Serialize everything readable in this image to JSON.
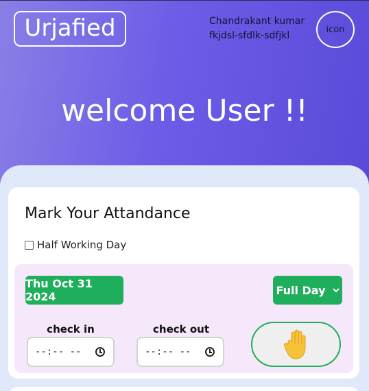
{
  "header": {
    "logo": "Urjafied",
    "user_name": "Chandrakant kumar",
    "user_id": "fkjdsl-sfdlk-sdfjkl",
    "avatar_text": "icon"
  },
  "hero": {
    "welcome": "welcome User !!"
  },
  "attendance": {
    "title": "Mark Your Attandance",
    "half_day_label": "Half Working Day",
    "half_day_checked": false,
    "date": "Thu Oct 31 2024",
    "day_type": "Full Day",
    "check_in_label": "check in",
    "check_in_value": "--:-- --",
    "check_out_label": "check out",
    "check_out_value": "--:-- --",
    "mark_button_icon": "raised-hand-icon"
  },
  "colors": {
    "accent_green": "#1fae5b",
    "hero_purple": "#6c5ce7",
    "panel_bg": "#dfe9f9",
    "inner_pink": "#f5e8fa"
  }
}
